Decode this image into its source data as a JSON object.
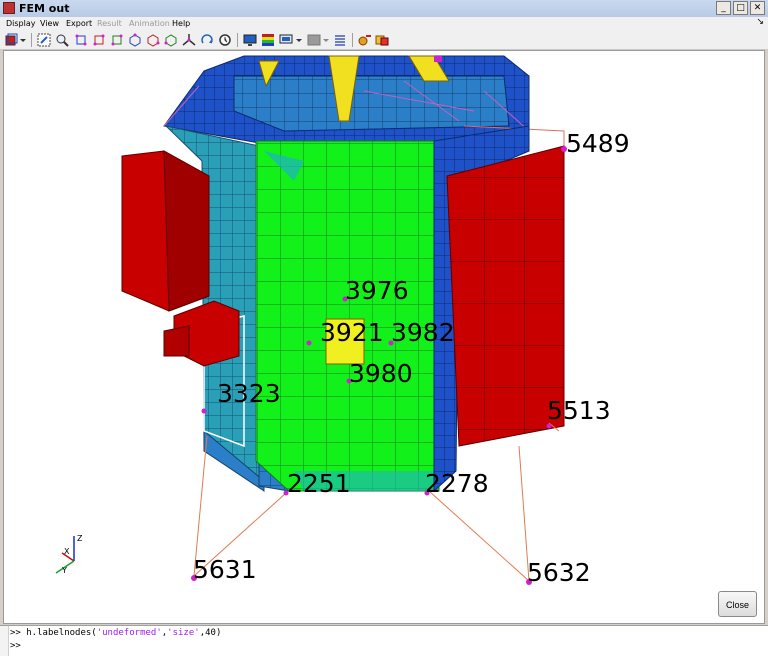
{
  "window": {
    "title": "FEM out"
  },
  "menu": {
    "items": [
      "Display",
      "View",
      "Export",
      "Result",
      "Animation",
      "Help"
    ]
  },
  "nodes": [
    {
      "label": "5489"
    },
    {
      "label": "3976"
    },
    {
      "label": "3921"
    },
    {
      "label": "3982"
    },
    {
      "label": "3980"
    },
    {
      "label": "3323"
    },
    {
      "label": "5513"
    },
    {
      "label": "2251"
    },
    {
      "label": "2278"
    },
    {
      "label": "5631"
    },
    {
      "label": "5632"
    }
  ],
  "axes": {
    "x": "X",
    "y": "Y",
    "z": "Z"
  },
  "close_label": "Close",
  "console": {
    "prompt": ">> ",
    "command_prefix": "h.labelnodes(",
    "arg1": "'undeformed'",
    "sep1": ",",
    "arg2": "'size'",
    "sep2": ",40)",
    "prompt2": ">>"
  }
}
